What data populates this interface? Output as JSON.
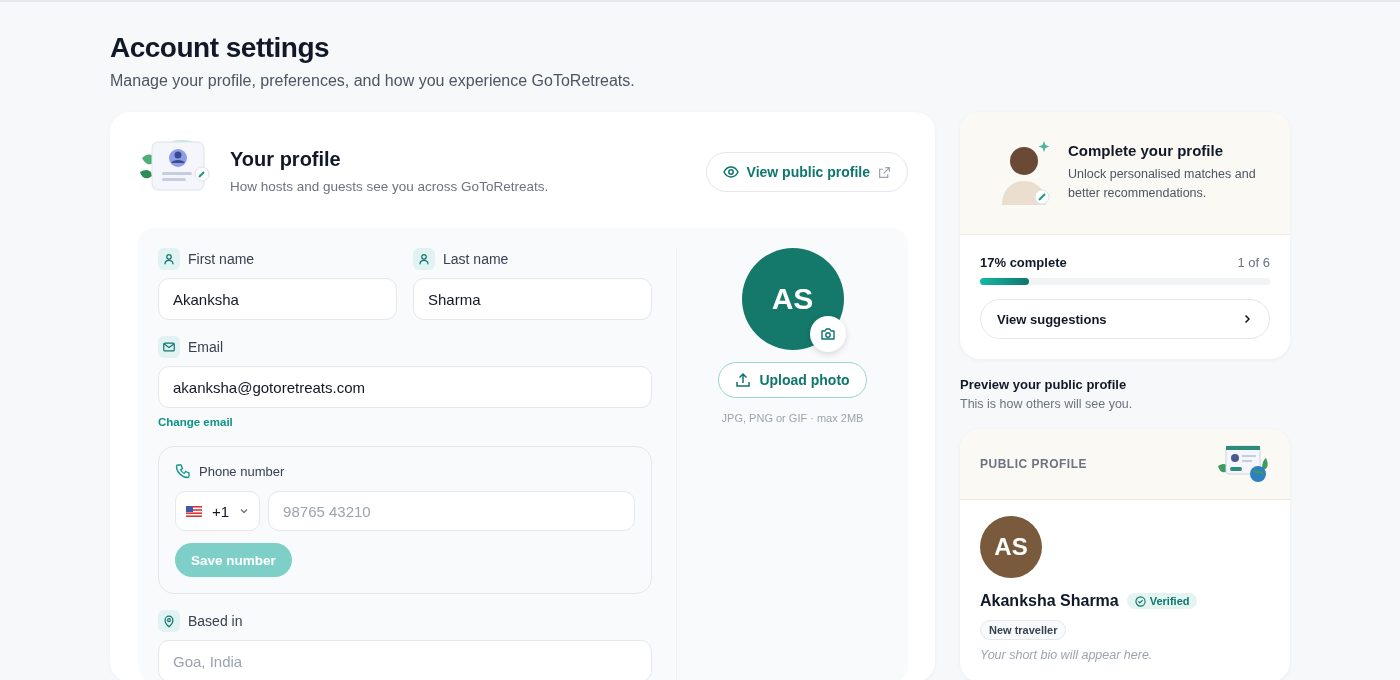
{
  "page": {
    "title": "Account settings",
    "subtitle": "Manage your profile, preferences, and how you experience GoToRetreats."
  },
  "profile_card": {
    "title": "Your profile",
    "subtitle": "How hosts and guests see you across GoToRetreats.",
    "view_button": "View public profile",
    "first_name": {
      "label": "First name",
      "value": "Akanksha"
    },
    "last_name": {
      "label": "Last name",
      "value": "Sharma"
    },
    "email": {
      "label": "Email",
      "value": "akanksha@gotoretreats.com",
      "change_link": "Change email"
    },
    "phone": {
      "label": "Phone number",
      "country_code": "+1",
      "placeholder": "98765 43210",
      "save_button": "Save number",
      "save_disabled": true
    },
    "based_in": {
      "label": "Based in",
      "placeholder": "Goa, India"
    },
    "photo": {
      "initials": "AS",
      "upload_button": "Upload photo",
      "hint": "JPG, PNG or GIF · max 2MB"
    }
  },
  "completion": {
    "title": "Complete your profile",
    "subtitle": "Unlock personalised matches and better recommendations.",
    "progress_label": "17% complete",
    "steps": "1 of 6",
    "level": 0.17,
    "button": "View suggestions"
  },
  "preview": {
    "title": "Preview your public profile",
    "subtitle": "This is how others will see you.",
    "card_label": "PUBLIC PROFILE",
    "initials": "AS",
    "name": "Akanksha Sharma",
    "verified_badge": "Verified",
    "tag": "New traveller",
    "bio_text": "Your short bio will appear here."
  }
}
